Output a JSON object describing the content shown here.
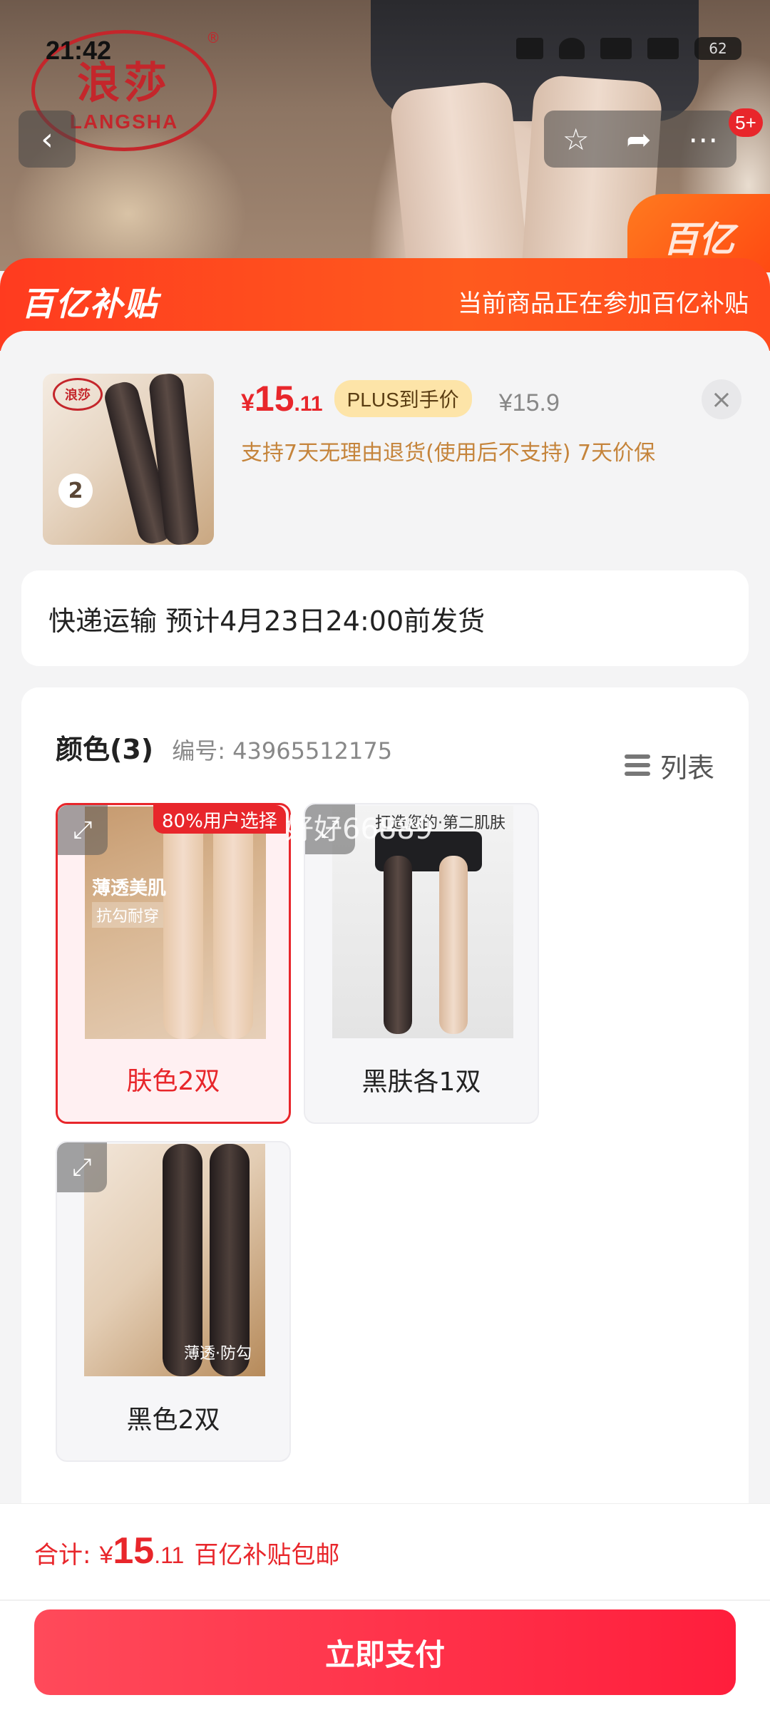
{
  "status_bar": {
    "time": "21:42",
    "battery": "62"
  },
  "brand": {
    "name_cn": "浪莎",
    "name_en": "LANGSHA",
    "reg": "®"
  },
  "top_nav": {
    "back_icon": "chevron-left-icon",
    "cart_count": "5+"
  },
  "corner_badge": "百亿",
  "subsidy_banner": {
    "logo": "百亿补贴",
    "text": "当前商品正在参加百亿补贴"
  },
  "product": {
    "price_currency": "¥",
    "price_int": "15",
    "price_dec": ".11",
    "plus_label": "PLUS到手价",
    "original_price": "¥15.9",
    "guarantee": "支持7天无理由退货(使用后不支持)  7天价保",
    "thumb_logo": "浪莎",
    "thumb_count": "2"
  },
  "shipping": {
    "text": "快递运输  预计4月23日24:00前发货"
  },
  "color_section": {
    "title": "颜色(3)",
    "sku_label": "编号: 43965512175",
    "list_label": "列表",
    "options": [
      {
        "label": "肤色2双",
        "selected": true,
        "badge": "80%用户选择",
        "img_t1": "薄透美肌",
        "img_t2": "抗勾耐穿"
      },
      {
        "label": "黑肤各1双",
        "selected": false,
        "img_t1": "打造您的·第二肌肤"
      },
      {
        "label": "黑色2双",
        "selected": false,
        "img_t1": "薄透·防勾"
      }
    ]
  },
  "watermark": "好好66889",
  "footer": {
    "total_label": "合计:",
    "currency": "¥",
    "total_int": "15",
    "total_dec": ".11",
    "shipping_note": "百亿补贴包邮",
    "pay_label": "立即支付"
  },
  "colors": {
    "accent_red": "#e8262b",
    "subsidy_orange": "#ff4a1d",
    "guarantee_gold": "#c5843b"
  }
}
